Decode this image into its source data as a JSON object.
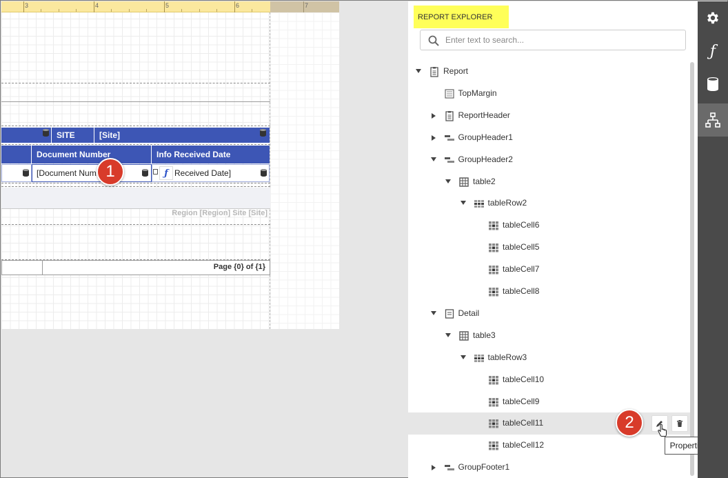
{
  "ruler": {
    "ticks": [
      "3",
      "4",
      "5",
      "6",
      "7"
    ]
  },
  "report_table": {
    "group_header": {
      "site_label": "SITE",
      "site_field": "[Site]"
    },
    "columns": [
      "Document Number",
      "Info Received Date"
    ],
    "cells": [
      "[Document Numb",
      "Received Date]"
    ],
    "footer": "Region [Region] Site [Site]",
    "page_info": "Page {0} of {1}"
  },
  "badges": [
    "1",
    "2"
  ],
  "explorer": {
    "title": "REPORT EXPLORER",
    "search_placeholder": "Enter text to search...",
    "tree": [
      {
        "label": "Report",
        "icon": "report-icon",
        "expander": "down"
      },
      {
        "label": "TopMargin",
        "icon": "band-icon",
        "expander": "none"
      },
      {
        "label": "ReportHeader",
        "icon": "report-icon",
        "expander": "right"
      },
      {
        "label": "GroupHeader1",
        "icon": "group-band-icon",
        "expander": "right"
      },
      {
        "label": "GroupHeader2",
        "icon": "group-band-icon",
        "expander": "down"
      },
      {
        "label": "table2",
        "icon": "table-icon",
        "expander": "down"
      },
      {
        "label": "tableRow2",
        "icon": "table-row-icon",
        "expander": "down"
      },
      {
        "label": "tableCell6",
        "icon": "table-cell-icon",
        "expander": "none"
      },
      {
        "label": "tableCell5",
        "icon": "table-cell-icon",
        "expander": "none"
      },
      {
        "label": "tableCell7",
        "icon": "table-cell-icon",
        "expander": "none"
      },
      {
        "label": "tableCell8",
        "icon": "table-cell-icon",
        "expander": "none"
      },
      {
        "label": "Detail",
        "icon": "detail-band-icon",
        "expander": "down"
      },
      {
        "label": "table3",
        "icon": "table-icon",
        "expander": "down"
      },
      {
        "label": "tableRow3",
        "icon": "table-row-icon",
        "expander": "down"
      },
      {
        "label": "tableCell10",
        "icon": "table-cell-icon",
        "expander": "none"
      },
      {
        "label": "tableCell9",
        "icon": "table-cell-icon",
        "expander": "none"
      },
      {
        "label": "tableCell11",
        "icon": "table-cell-icon",
        "expander": "none"
      },
      {
        "label": "tableCell12",
        "icon": "table-cell-icon",
        "expander": "none"
      },
      {
        "label": "GroupFooter1",
        "icon": "group-band-icon",
        "expander": "right"
      }
    ],
    "tooltip": "Properties"
  },
  "sidebar": {
    "items": [
      "gear-icon",
      "function-icon",
      "database-icon",
      "report-explorer-icon"
    ]
  },
  "colors": {
    "table_header": "#3d56b5",
    "badge": "#d83b2a",
    "explorer_title_highlight": "#ffff59",
    "sidebar": "#4a4a4a"
  }
}
